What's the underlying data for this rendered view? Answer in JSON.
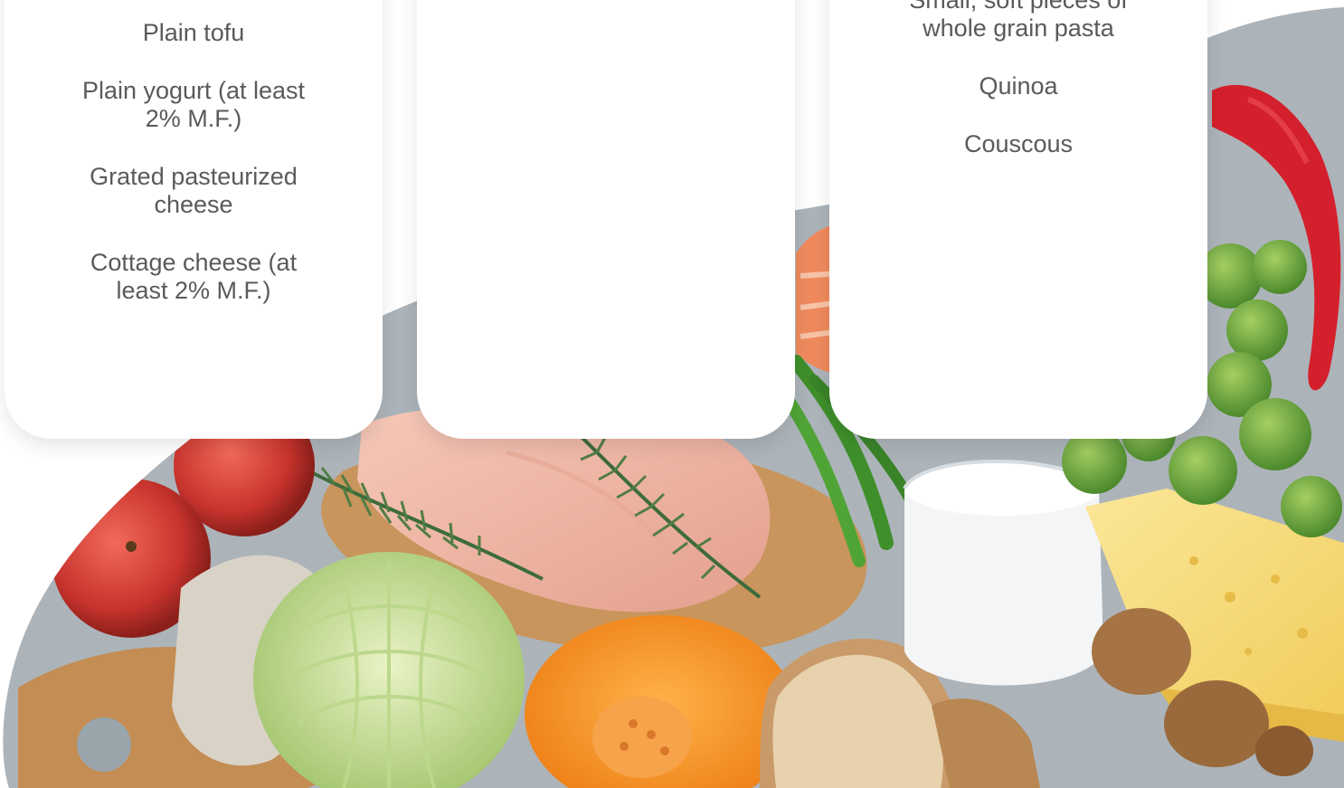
{
  "cards": [
    {
      "items": [
        "Plain tofu",
        "Plain yogurt (at least 2% M.F.)",
        "Grated pasteurized cheese",
        "Cottage cheese (at least 2% M.F.)"
      ]
    },
    {
      "items": []
    },
    {
      "items": [
        "Small, soft pieces of whole grain pasta",
        "Quinoa",
        "Couscous"
      ]
    }
  ],
  "image": {
    "subject": "healthy-food-spread-photo"
  }
}
